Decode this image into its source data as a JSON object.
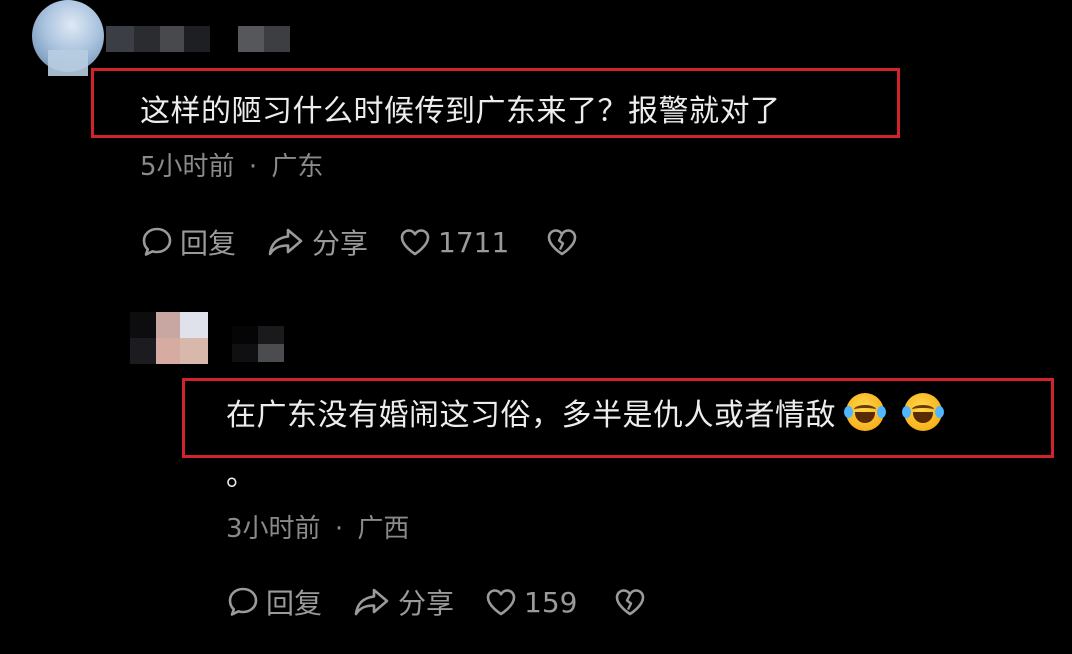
{
  "comments": [
    {
      "text": "这样的陋习什么时候传到广东来了？报警就对了",
      "time": "5小时前",
      "separator": "·",
      "region": "广东",
      "reply_label": "回复",
      "share_label": "分享",
      "like_count": "1711"
    },
    {
      "text": "在广东没有婚闹这习俗，多半是仇人或者情敌",
      "text_tail": "。",
      "emoji": [
        "rolling-on-floor-laughing",
        "rolling-on-floor-laughing"
      ],
      "time": "3小时前",
      "separator": "·",
      "region": "广西",
      "reply_label": "回复",
      "share_label": "分享",
      "like_count": "159"
    }
  ],
  "colors": {
    "background": "#000000",
    "text": "#ededed",
    "meta": "#8a8a8a",
    "action": "#9a9a9a",
    "highlight": "#d2232a"
  }
}
